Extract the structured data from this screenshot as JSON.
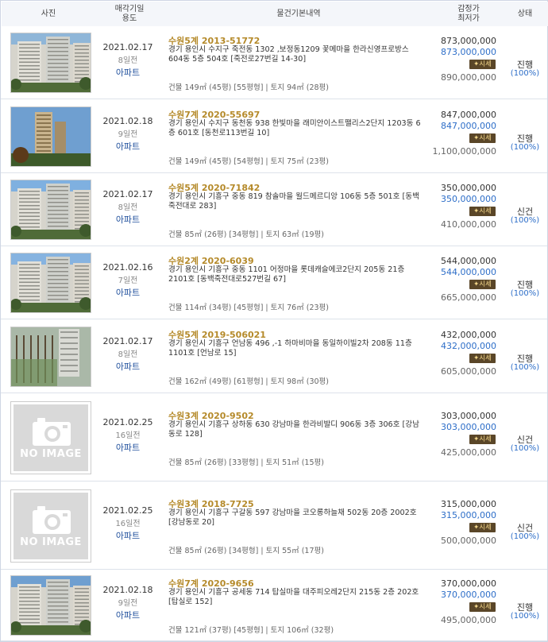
{
  "header": {
    "photo": "사진",
    "date_line1": "매각기일",
    "date_line2": "용도",
    "desc": "물건기본내역",
    "price_line1": "감정가",
    "price_line2": "최저가",
    "status": "상태"
  },
  "no_image_text": "NO IMAGE",
  "market_badge": "시세",
  "rows": [
    {
      "date": "2021.02.17",
      "days": "8일전",
      "use": "아파트",
      "case": "수원5계 2013-51772",
      "addr": "경기 용인시 수지구 죽전동 1302 ,보정동1209 꽃메마을 한라신영프로방스 604동 5층 504호 [죽전로27번길 14-30]",
      "area": "건물 149㎡ (45평) [55평형]  |  토지 94㎡ (28평)",
      "appraisal": "873,000,000",
      "minimum": "873,000,000",
      "market": "890,000,000",
      "status": "진행",
      "pct": "(100%)",
      "image": "photo"
    },
    {
      "date": "2021.02.18",
      "days": "9일전",
      "use": "아파트",
      "case": "수원7계 2020-55697",
      "addr": "경기 용인시 수지구 동천동 938 한빛마을 래미안이스트팰리스2단지 1203동 6층 601호 [동천로113번길 10]",
      "area": "건물 149㎡ (45평) [54평형]  |  토지 75㎡ (23평)",
      "appraisal": "847,000,000",
      "minimum": "847,000,000",
      "market": "1,100,000,000",
      "status": "진행",
      "pct": "(100%)",
      "image": "photo"
    },
    {
      "date": "2021.02.17",
      "days": "8일전",
      "use": "아파트",
      "case": "수원5계 2020-71842",
      "addr": "경기 용인시 기흥구 중동 819 참솔마을 월드메르디앙 106동 5층 501호 [동백죽전대로 283]",
      "area": "건물 85㎡ (26평) [34평형]  |  토지 63㎡ (19평)",
      "appraisal": "350,000,000",
      "minimum": "350,000,000",
      "market": "410,000,000",
      "status": "신건",
      "pct": "(100%)",
      "image": "photo"
    },
    {
      "date": "2021.02.16",
      "days": "7일전",
      "use": "아파트",
      "case": "수원2계 2020-6039",
      "addr": "경기 용인시 기흥구 중동 1101 어정마을 롯데캐슬에코2단지 205동 21층 2101호 [동백죽전대로527번길 67]",
      "area": "건물 114㎡ (34평) [45평형]  |  토지 76㎡ (23평)",
      "appraisal": "544,000,000",
      "minimum": "544,000,000",
      "market": "665,000,000",
      "status": "진행",
      "pct": "(100%)",
      "image": "photo"
    },
    {
      "date": "2021.02.17",
      "days": "8일전",
      "use": "아파트",
      "case": "수원5계 2019-506021",
      "addr": "경기 용인시 기흥구 언남동 496 ,-1 하마비마을 동일하이빌2차 208동 11층 1101호 [언남로 15]",
      "area": "건물 162㎡ (49평) [61평형]  |  토지 98㎡ (30평)",
      "appraisal": "432,000,000",
      "minimum": "432,000,000",
      "market": "605,000,000",
      "status": "진행",
      "pct": "(100%)",
      "image": "photo"
    },
    {
      "date": "2021.02.25",
      "days": "16일전",
      "use": "아파트",
      "case": "수원3계 2020-9502",
      "addr": "경기 용인시 기흥구 상하동 630 강남마을 한라비발디 906동 3층 306호 [강남동로 128]",
      "area": "건물 85㎡ (26평) [33평형]  |  토지 51㎡ (15평)",
      "appraisal": "303,000,000",
      "minimum": "303,000,000",
      "market": "425,000,000",
      "status": "신건",
      "pct": "(100%)",
      "image": "none"
    },
    {
      "date": "2021.02.25",
      "days": "16일전",
      "use": "아파트",
      "case": "수원3계 2018-7725",
      "addr": "경기 용인시 기흥구 구갈동 597 강남마을 코오롱하늘채 502동 20층 2002호 [강남동로 20]",
      "area": "건물 85㎡ (26평) [34평형]  |  토지 55㎡ (17평)",
      "appraisal": "315,000,000",
      "minimum": "315,000,000",
      "market": "500,000,000",
      "status": "신건",
      "pct": "(100%)",
      "image": "none"
    },
    {
      "date": "2021.02.18",
      "days": "9일전",
      "use": "아파트",
      "case": "수원7계 2020-9656",
      "addr": "경기 용인시 기흥구 공세동 714 탑실마을 대주피오레2단지 215동 2층 202호 [탑실로 152]",
      "area": "건물 121㎡ (37평) [45평형]  |  토지 106㎡ (32평)",
      "appraisal": "370,000,000",
      "minimum": "370,000,000",
      "market": "495,000,000",
      "status": "진행",
      "pct": "(100%)",
      "image": "photo"
    }
  ]
}
